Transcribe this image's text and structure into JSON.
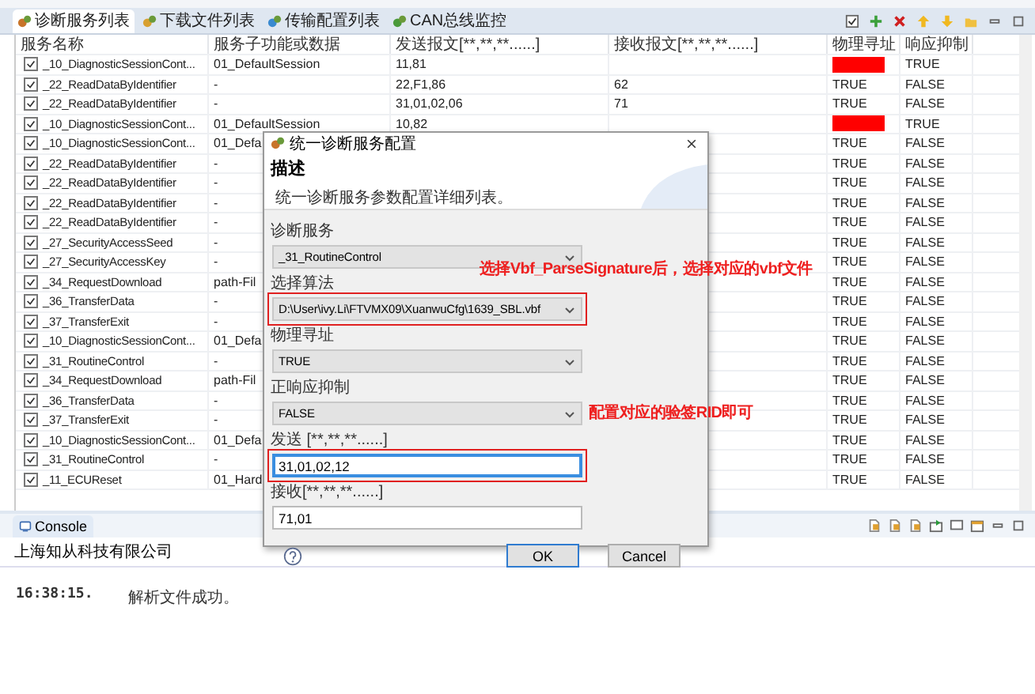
{
  "tabs": [
    {
      "label": "诊断服务列表",
      "selected": true
    },
    {
      "label": "下载文件列表",
      "selected": false
    },
    {
      "label": "传输配置列表",
      "selected": false
    },
    {
      "label": "CAN总线监控",
      "selected": false
    }
  ],
  "table": {
    "columns": [
      "服务名称",
      "服务子功能或数据",
      "发送报文[**,**,**......]",
      "接收报文[**,**,**......]",
      "物理寻址",
      "响应抑制"
    ],
    "rows": [
      {
        "checked": true,
        "name": "_10_DiagnosticSessionCont...",
        "sub": "01_DefaultSession",
        "send": "11,81",
        "phys_invalid": true,
        "suppress": "TRUE"
      },
      {
        "checked": true,
        "name": "_22_ReadDataByIdentifier",
        "sub": "-",
        "send": "22,F1,86",
        "recv": "62",
        "phys_invalid": false,
        "phys": "TRUE",
        "suppress": "FALSE"
      },
      {
        "checked": true,
        "name": "_22_ReadDataByIdentifier",
        "sub": "-",
        "send": "31,01,02,06",
        "recv": "71",
        "phys_invalid": false,
        "phys": "TRUE",
        "suppress": "FALSE"
      },
      {
        "checked": true,
        "name": "_10_DiagnosticSessionCont...",
        "sub": "01_DefaultSession",
        "send": "10,82",
        "phys_invalid": true,
        "suppress": "TRUE"
      },
      {
        "checked": true,
        "name": "_10_DiagnosticSessionCont...",
        "sub": "01_Defa",
        "phys_invalid": false,
        "phys": "TRUE",
        "suppress": "FALSE"
      },
      {
        "checked": true,
        "name": "_22_ReadDataByIdentifier",
        "sub": "-",
        "phys_invalid": false,
        "phys": "TRUE",
        "suppress": "FALSE"
      },
      {
        "checked": true,
        "name": "_22_ReadDataByIdentifier",
        "sub": "-",
        "phys_invalid": false,
        "phys": "TRUE",
        "suppress": "FALSE"
      },
      {
        "checked": true,
        "name": "_22_ReadDataByIdentifier",
        "sub": "-",
        "phys_invalid": false,
        "phys": "TRUE",
        "suppress": "FALSE"
      },
      {
        "checked": true,
        "name": "_22_ReadDataByIdentifier",
        "sub": "-",
        "phys_invalid": false,
        "phys": "TRUE",
        "suppress": "FALSE"
      },
      {
        "checked": true,
        "name": "_27_SecurityAccessSeed",
        "sub": "-",
        "phys_invalid": false,
        "phys": "TRUE",
        "suppress": "FALSE"
      },
      {
        "checked": true,
        "name": "_27_SecurityAccessKey",
        "sub": "-",
        "phys_invalid": false,
        "phys": "TRUE",
        "suppress": "FALSE"
      },
      {
        "checked": true,
        "name": "_34_RequestDownload",
        "sub": "path-Fil",
        "phys_invalid": false,
        "phys": "TRUE",
        "suppress": "FALSE"
      },
      {
        "checked": true,
        "name": "_36_TransferData",
        "sub": "-",
        "phys_invalid": false,
        "phys": "TRUE",
        "suppress": "FALSE"
      },
      {
        "checked": true,
        "name": "_37_TransferExit",
        "sub": "-",
        "phys_invalid": false,
        "phys": "TRUE",
        "suppress": "FALSE"
      },
      {
        "checked": true,
        "name": "_10_DiagnosticSessionCont...",
        "sub": "01_Defa",
        "phys_invalid": false,
        "phys": "TRUE",
        "suppress": "FALSE"
      },
      {
        "checked": true,
        "name": "_31_RoutineControl",
        "sub": "-",
        "phys_invalid": false,
        "phys": "TRUE",
        "suppress": "FALSE"
      },
      {
        "checked": true,
        "name": "_34_RequestDownload",
        "sub": "path-Fil",
        "phys_invalid": false,
        "phys": "TRUE",
        "suppress": "FALSE"
      },
      {
        "checked": true,
        "name": "_36_TransferData",
        "sub": "-",
        "phys_invalid": false,
        "phys": "TRUE",
        "suppress": "FALSE"
      },
      {
        "checked": true,
        "name": "_37_TransferExit",
        "sub": "-",
        "phys_invalid": false,
        "phys": "TRUE",
        "suppress": "FALSE"
      },
      {
        "checked": true,
        "name": "_10_DiagnosticSessionCont...",
        "sub": "01_Defa",
        "phys_invalid": false,
        "phys": "TRUE",
        "suppress": "FALSE"
      },
      {
        "checked": true,
        "name": "_31_RoutineControl",
        "sub": "-",
        "phys_invalid": false,
        "phys": "TRUE",
        "suppress": "FALSE"
      },
      {
        "checked": true,
        "name": "_11_ECUReset",
        "sub": "01_Hard",
        "phys_invalid": false,
        "phys": "TRUE",
        "suppress": "FALSE"
      }
    ]
  },
  "dialog": {
    "title": "统一诊断服务配置",
    "heading": "描述",
    "description": "统一诊断服务参数配置详细列表。",
    "fields": [
      {
        "kind": "combo",
        "label": "诊断服务",
        "value": "_31_RoutineControl",
        "highlighted": false
      },
      {
        "kind": "combo",
        "label": "选择算法",
        "value": "D:\\User\\ivy.Li\\FTVMX09\\XuanwuCfg\\1639_SBL.vbf",
        "highlighted": true
      },
      {
        "kind": "combo",
        "label": "物理寻址",
        "value": "TRUE",
        "highlighted": false
      },
      {
        "kind": "combo",
        "label": "正响应抑制",
        "value": "FALSE",
        "highlighted": false
      },
      {
        "kind": "text",
        "label": "发送 [**,**,**......]",
        "value": "31,01,02,12",
        "highlighted": true,
        "focused": true
      },
      {
        "kind": "text",
        "label": "接收[**,**,**......]",
        "value": "71,01",
        "highlighted": false,
        "focused": false
      }
    ],
    "buttons": [
      {
        "label": "OK",
        "default": true
      },
      {
        "label": "Cancel",
        "default": false
      }
    ]
  },
  "annotations": [
    "选择Vbf_ParseSignature后，选择对应的vbf文件",
    "配置对应的验签RID即可"
  ],
  "console": {
    "tab": "Console",
    "owner": "上海知从科技有限公司",
    "lines": [
      {
        "time": "16:38:15.",
        "message": "解析文件成功。"
      }
    ]
  }
}
